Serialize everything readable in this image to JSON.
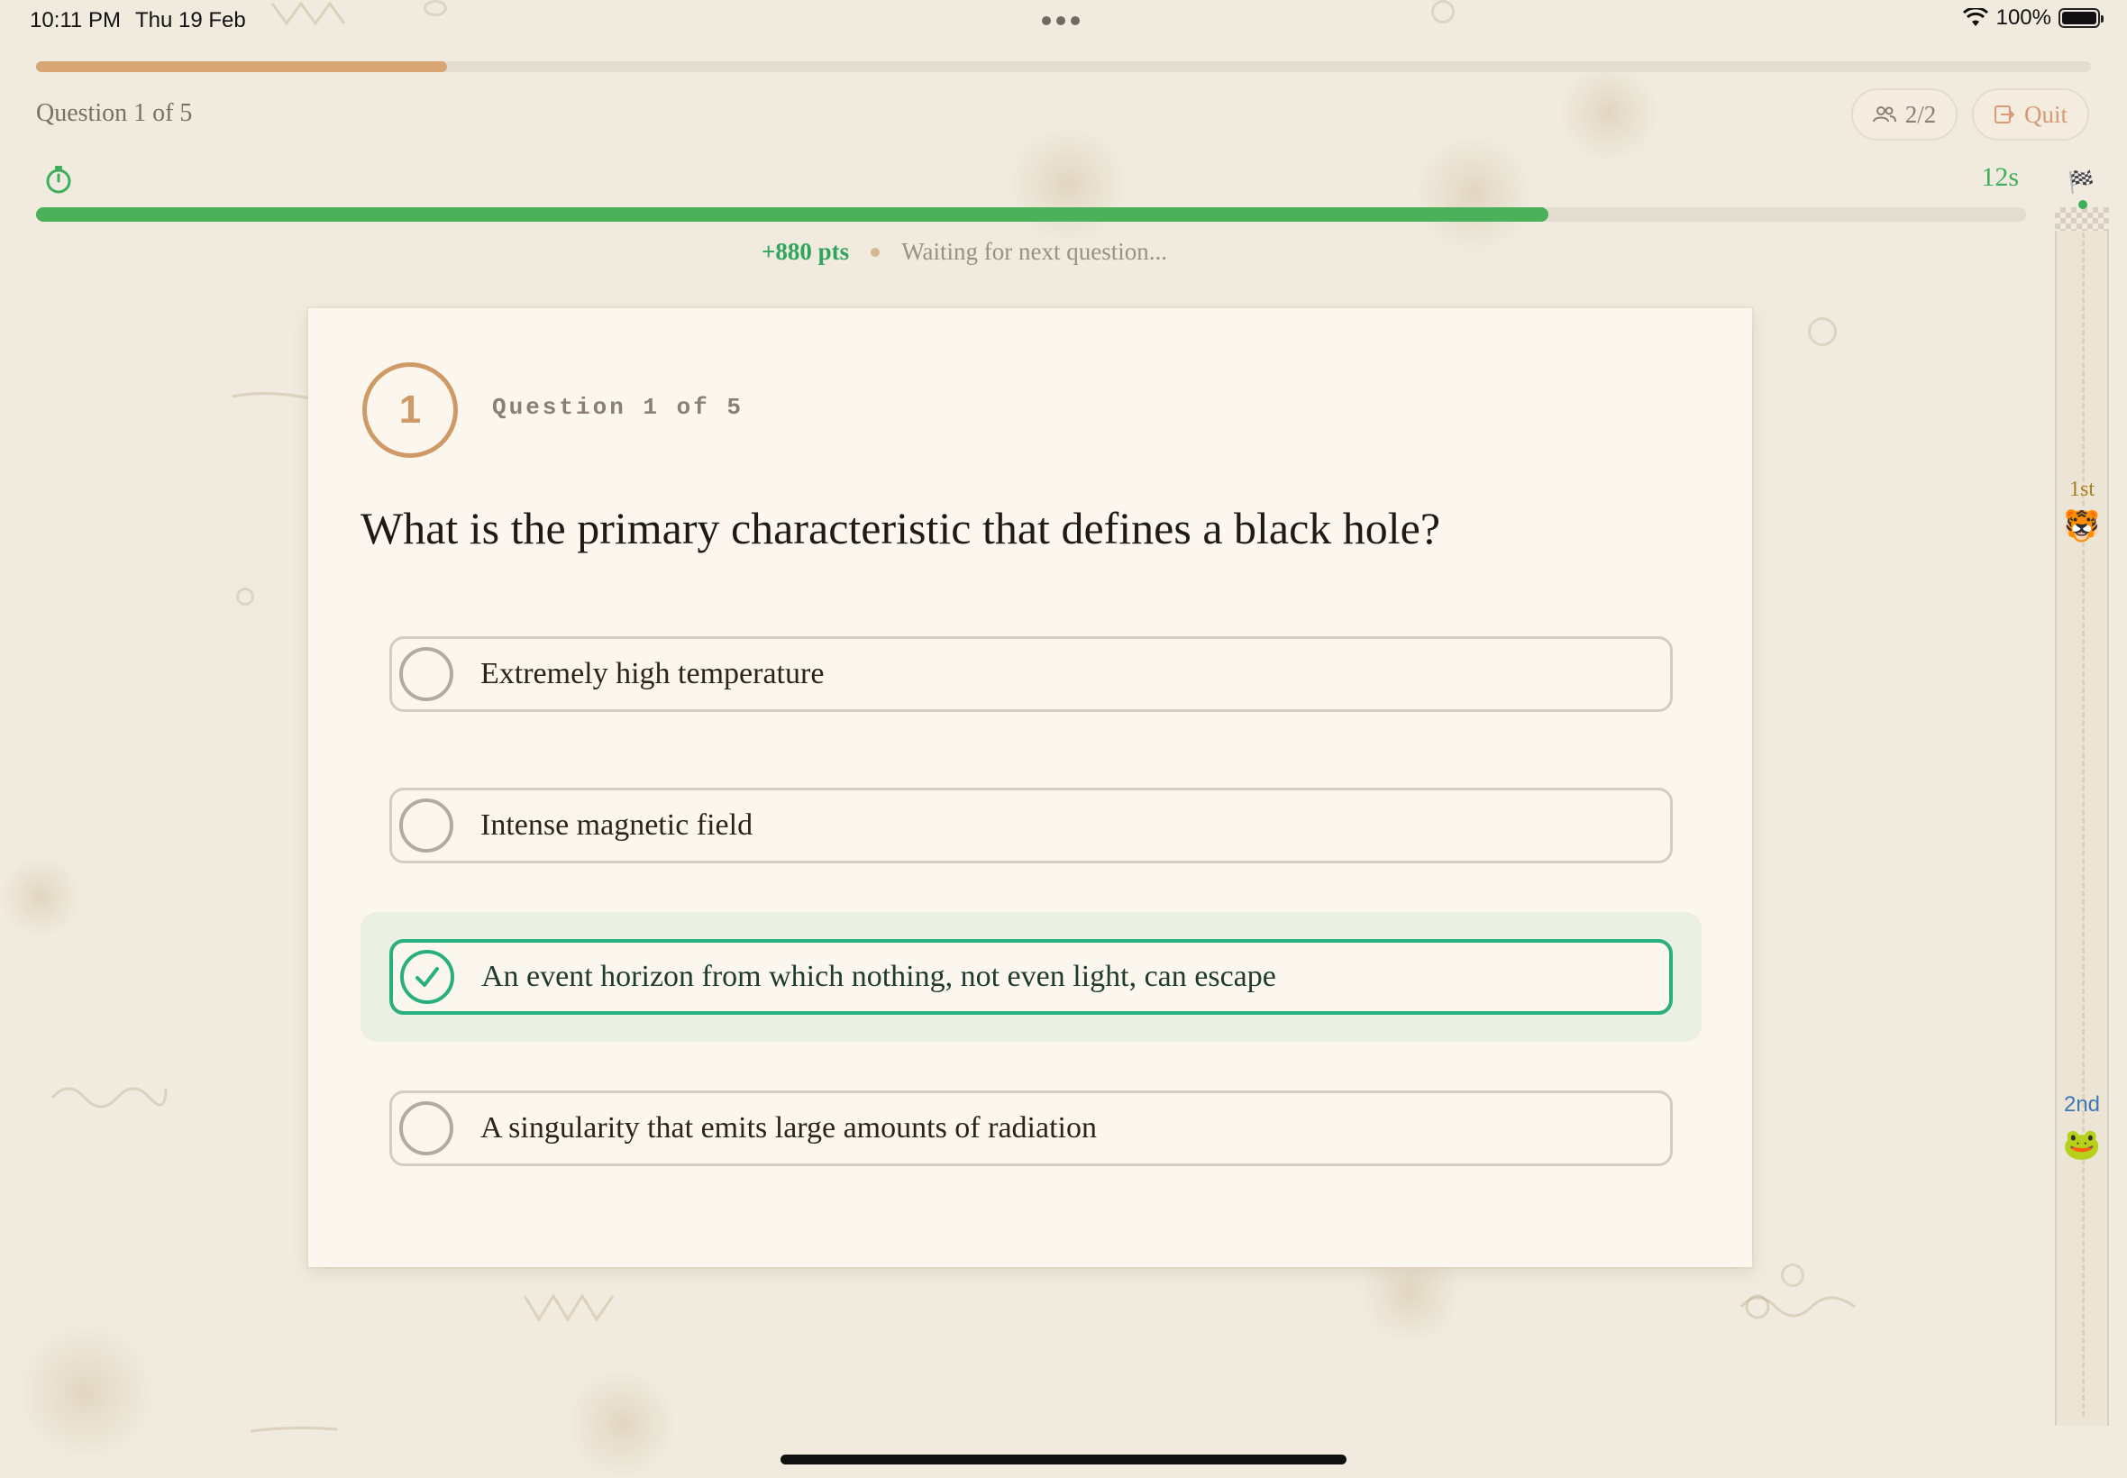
{
  "status_bar": {
    "time": "10:11 PM",
    "date": "Thu 19 Feb",
    "battery": "100%"
  },
  "header": {
    "progress_fraction": 0.2,
    "question_counter": "Question 1 of 5",
    "players_label": "2/2",
    "quit_label": "Quit"
  },
  "timer": {
    "seconds_label": "12s",
    "remaining_fraction": 0.76
  },
  "score": {
    "points": "+880 pts",
    "waiting_text": "Waiting for next question..."
  },
  "card": {
    "number": "1",
    "label": "Question 1 of 5",
    "question": "What is the primary characteristic that defines a black hole?",
    "answers": [
      {
        "text": "Extremely high temperature",
        "correct": false
      },
      {
        "text": "Intense magnetic field",
        "correct": false
      },
      {
        "text": "An event horizon from which nothing, not even light, can escape",
        "correct": true
      },
      {
        "text": "A singularity that emits large amounts of radiation",
        "correct": false
      }
    ]
  },
  "race": {
    "finish_icon": "checkered-flag-icon",
    "players": [
      {
        "rank": "1st",
        "avatar": "🐯",
        "avatar_name": "tiger-avatar"
      },
      {
        "rank": "2nd",
        "avatar": "🐸",
        "avatar_name": "frog-avatar"
      }
    ]
  },
  "colors": {
    "background": "#f0ebde",
    "progress_orange": "#d8a574",
    "timer_green": "#4bb05a",
    "correct_green": "#27b07e",
    "card": "#fbf7ee"
  }
}
